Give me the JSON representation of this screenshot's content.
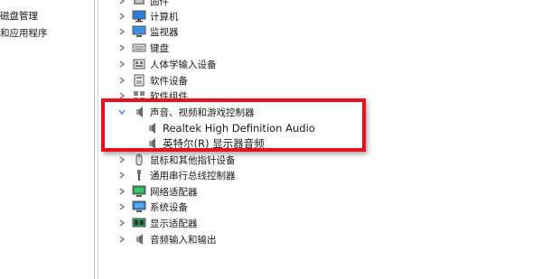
{
  "left_pane": {
    "items": [
      {
        "label": "磁盘管理"
      },
      {
        "label": "和应用程序"
      }
    ]
  },
  "tree": {
    "categories": [
      {
        "label": "固件",
        "icon": "firmware-icon",
        "expanded": false
      },
      {
        "label": "计算机",
        "icon": "computer-icon",
        "expanded": false
      },
      {
        "label": "监视器",
        "icon": "monitor-icon",
        "expanded": false
      },
      {
        "label": "键盘",
        "icon": "keyboard-icon",
        "expanded": false
      },
      {
        "label": "人体学输入设备",
        "icon": "hid-icon",
        "expanded": false
      },
      {
        "label": "软件设备",
        "icon": "software-device-icon",
        "expanded": false
      },
      {
        "label": "软件组件",
        "icon": "software-component-icon",
        "expanded": false
      },
      {
        "label": "声音、视频和游戏控制器",
        "icon": "speaker-icon",
        "expanded": true,
        "children": [
          {
            "label": "Realtek High Definition Audio",
            "icon": "speaker-icon"
          },
          {
            "label": "英特尔(R) 显示器音频",
            "icon": "speaker-icon"
          }
        ]
      },
      {
        "label": "鼠标和其他指针设备",
        "icon": "mouse-icon",
        "expanded": false
      },
      {
        "label": "通用串行总线控制器",
        "icon": "usb-icon",
        "expanded": false
      },
      {
        "label": "网络适配器",
        "icon": "network-adapter-icon",
        "expanded": false
      },
      {
        "label": "系统设备",
        "icon": "system-device-icon",
        "expanded": false
      },
      {
        "label": "显示适配器",
        "icon": "display-adapter-icon",
        "expanded": false
      },
      {
        "label": "音频输入和输出",
        "icon": "audio-io-icon",
        "expanded": false
      }
    ]
  },
  "colors": {
    "highlight": "#e8101a",
    "chevron": "#666666",
    "icon_blue": "#2a7fd4"
  }
}
